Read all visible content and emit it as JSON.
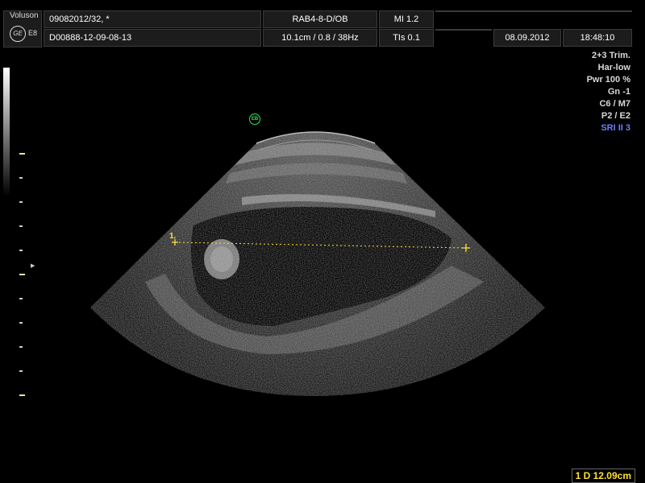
{
  "header": {
    "brand": "Voluson",
    "logo_text": "GE",
    "model": "E8",
    "patient_id": "09082012/32,  *",
    "probe_preset": "RAB4-8-D/OB",
    "mi": "MI  1.2",
    "exam_id": "D00888-12-09-08-13",
    "depth_info": "10.1cm / 0.8 / 38Hz",
    "tis": "TIs  0.1",
    "date": "08.09.2012",
    "time": "18:48:10"
  },
  "info_panel": {
    "lines": [
      "2+3 Trim.",
      "Har-low",
      "Pwr 100 %",
      "Gn  -1",
      "C6 / M7",
      "P2 / E2"
    ],
    "sri": "SRI II 3"
  },
  "overlay": {
    "focus_marker": "EB",
    "caliper_label": "1."
  },
  "measurement": {
    "text": "1  D 12.09cm"
  },
  "colors": {
    "caliper": "#ffe030",
    "focus": "#2ee84d",
    "sri": "#6b7cff"
  }
}
